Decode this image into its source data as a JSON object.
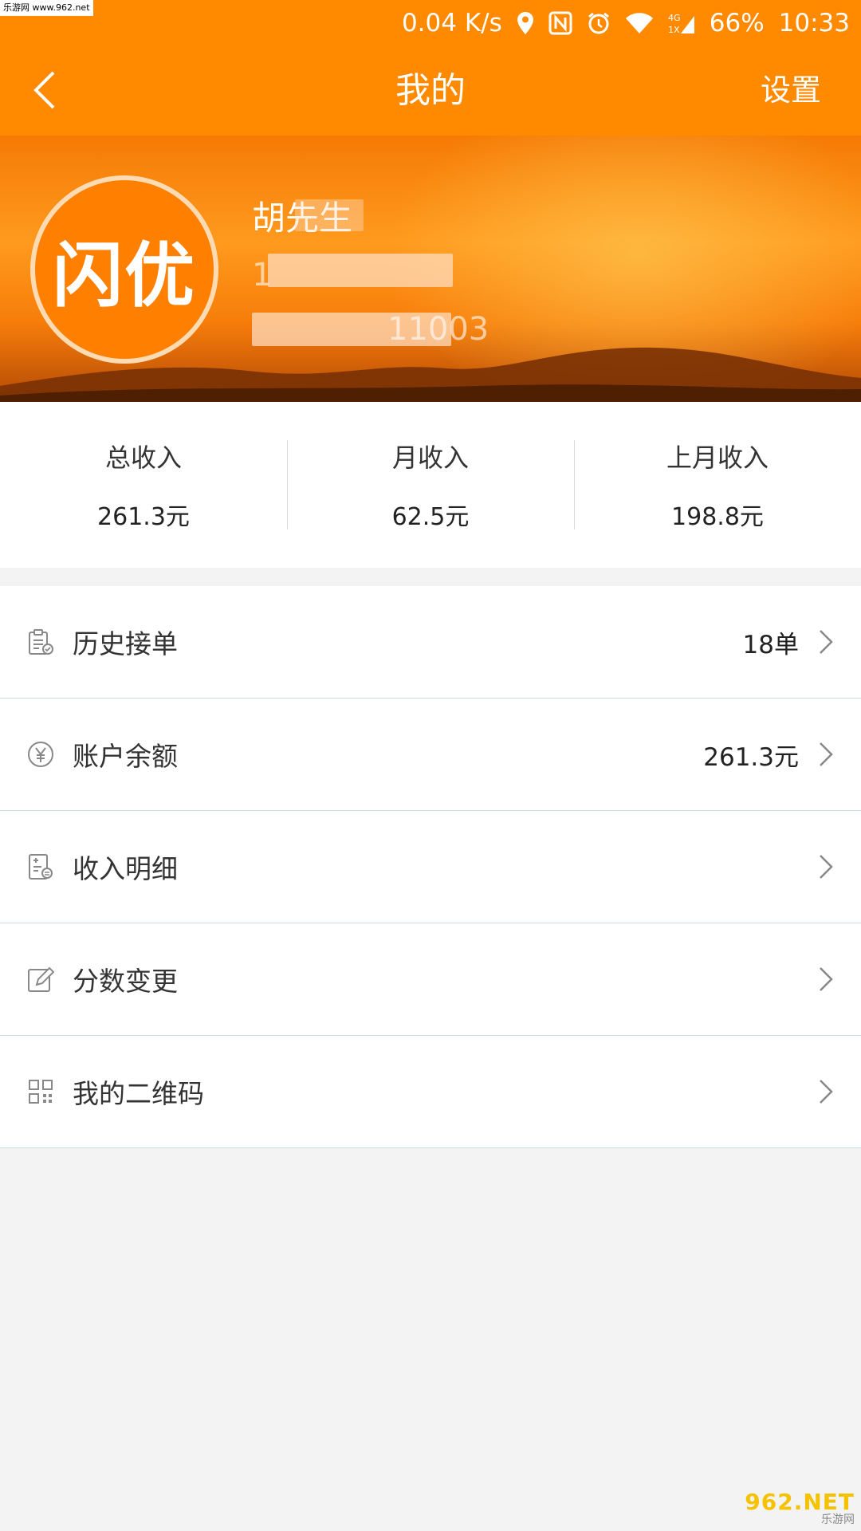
{
  "watermark": {
    "top": "乐游网 www.962.net",
    "bottom_logo": "962.NET",
    "bottom_sub": "乐游网"
  },
  "status_bar": {
    "network_speed": "0.04 K/s",
    "battery": "66%",
    "time": "10:33",
    "icons": [
      "location-icon",
      "nfc-icon",
      "alarm-icon",
      "wifi-icon",
      "signal-4g-icon"
    ]
  },
  "nav": {
    "title": "我的",
    "back_icon": "chevron-left-icon",
    "settings_label": "设置"
  },
  "profile": {
    "avatar_text": "闪优",
    "name": "胡先生",
    "phone_visible": "1",
    "id_visible": "11003"
  },
  "stats": [
    {
      "label": "总收入",
      "value": "261.3元"
    },
    {
      "label": "月收入",
      "value": "62.5元"
    },
    {
      "label": "上月收入",
      "value": "198.8元"
    }
  ],
  "menu": [
    {
      "label": "历史接单",
      "value": "18单",
      "icon": "clipboard-icon"
    },
    {
      "label": "账户余额",
      "value": "261.3元",
      "icon": "yuan-icon"
    },
    {
      "label": "收入明细",
      "value": "",
      "icon": "receipt-icon"
    },
    {
      "label": "分数变更",
      "value": "",
      "icon": "edit-icon"
    },
    {
      "label": "我的二维码",
      "value": "",
      "icon": "qrcode-icon"
    }
  ],
  "colors": {
    "brand": "#ff8a00",
    "divider": "#c7dde0",
    "background": "#f3f3f3"
  }
}
